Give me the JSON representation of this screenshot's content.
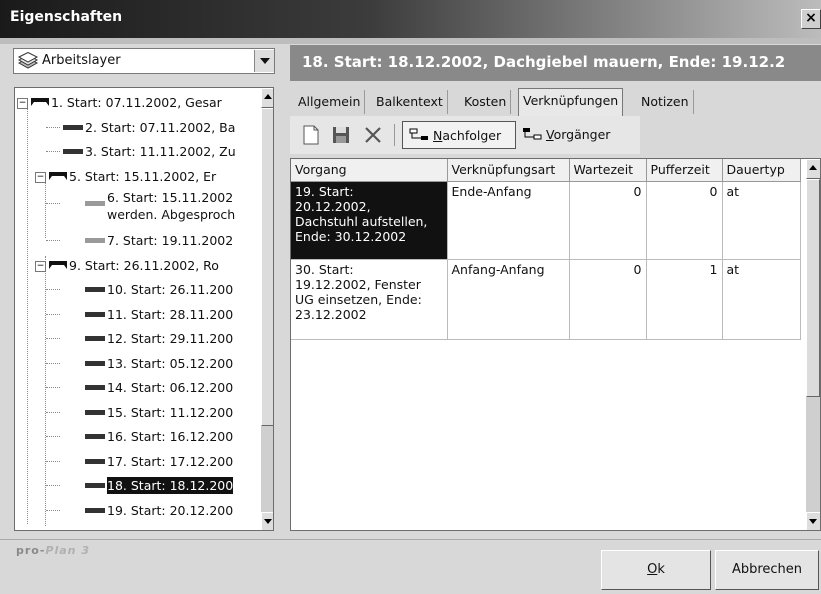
{
  "window": {
    "title": "Eigenschaften",
    "close_glyph": "×"
  },
  "layer": {
    "icon": "layers-icon",
    "value": "Arbeitslayer"
  },
  "header": {
    "text": "18. Start: 18.12.2002, Dachgiebel mauern, Ende: 19.12.2"
  },
  "tree": {
    "items": [
      {
        "label": "1. Start: 07.11.2002, Gesar",
        "type": "summary",
        "expanded": true
      },
      {
        "label": "2. Start: 07.11.2002, Ba",
        "type": "task"
      },
      {
        "label": "3. Start: 11.11.2002, Zu",
        "type": "task"
      },
      {
        "label": "5. Start: 15.11.2002, Er",
        "type": "summary",
        "expanded": true
      },
      {
        "label": "6. Start: 15.11.2002",
        "label2": "werden. Abgesproch",
        "type": "task-gray"
      },
      {
        "label": "7. Start: 19.11.2002",
        "type": "task-gray"
      },
      {
        "label": "9. Start: 26.11.2002, Ro",
        "type": "summary",
        "expanded": true
      },
      {
        "label": "10. Start: 26.11.200",
        "type": "task"
      },
      {
        "label": "11. Start: 28.11.200",
        "type": "task"
      },
      {
        "label": "12. Start: 29.11.200",
        "type": "task"
      },
      {
        "label": "13. Start: 05.12.200",
        "type": "task"
      },
      {
        "label": "14. Start: 06.12.200",
        "type": "task"
      },
      {
        "label": "15. Start: 11.12.200",
        "type": "task"
      },
      {
        "label": "16. Start: 16.12.200",
        "type": "task"
      },
      {
        "label": "17. Start: 17.12.200",
        "type": "task"
      },
      {
        "label": "18. Start: 18.12.200",
        "type": "task",
        "selected": true
      },
      {
        "label": "19. Start: 20.12.200",
        "type": "task"
      }
    ]
  },
  "tabs": [
    {
      "label": "Allgemein"
    },
    {
      "label": "Balkentext"
    },
    {
      "label": "Kosten"
    },
    {
      "label": "Verknüpfungen",
      "active": true
    },
    {
      "label": "Notizen"
    }
  ],
  "toolbar": {
    "icons": [
      "new-document-icon",
      "save-icon",
      "delete-icon"
    ],
    "nachfolger": {
      "mnemonic": "N",
      "rest": "achfolger",
      "pressed": true,
      "icon": "successor-link-icon"
    },
    "vorgaenger": {
      "mnemonic": "V",
      "rest": "orgänger",
      "pressed": false,
      "icon": "predecessor-link-icon"
    }
  },
  "grid": {
    "columns": [
      "Vorgang",
      "Verknüpfungsart",
      "Wartezeit",
      "Pufferzeit",
      "Dauertyp"
    ],
    "rows": [
      {
        "vorgang": [
          "19. Start:",
          "20.12.2002,",
          "Dachstuhl aufstellen,",
          "Ende: 30.12.2002"
        ],
        "art": "Ende-Anfang",
        "wartezeit": "0",
        "pufferzeit": "0",
        "dauertyp": "at",
        "selected": true
      },
      {
        "vorgang": [
          "30. Start:",
          "19.12.2002, Fenster",
          "UG einsetzen, Ende:",
          "23.12.2002"
        ],
        "art": "Anfang-Anfang",
        "wartezeit": "0",
        "pufferzeit": "1",
        "dauertyp": "at",
        "selected": false
      }
    ]
  },
  "footer": {
    "brand_a": "pro-",
    "brand_b": "Plan 3",
    "ok_mnemonic": "O",
    "ok_rest": "k",
    "cancel": "Abbrechen"
  }
}
